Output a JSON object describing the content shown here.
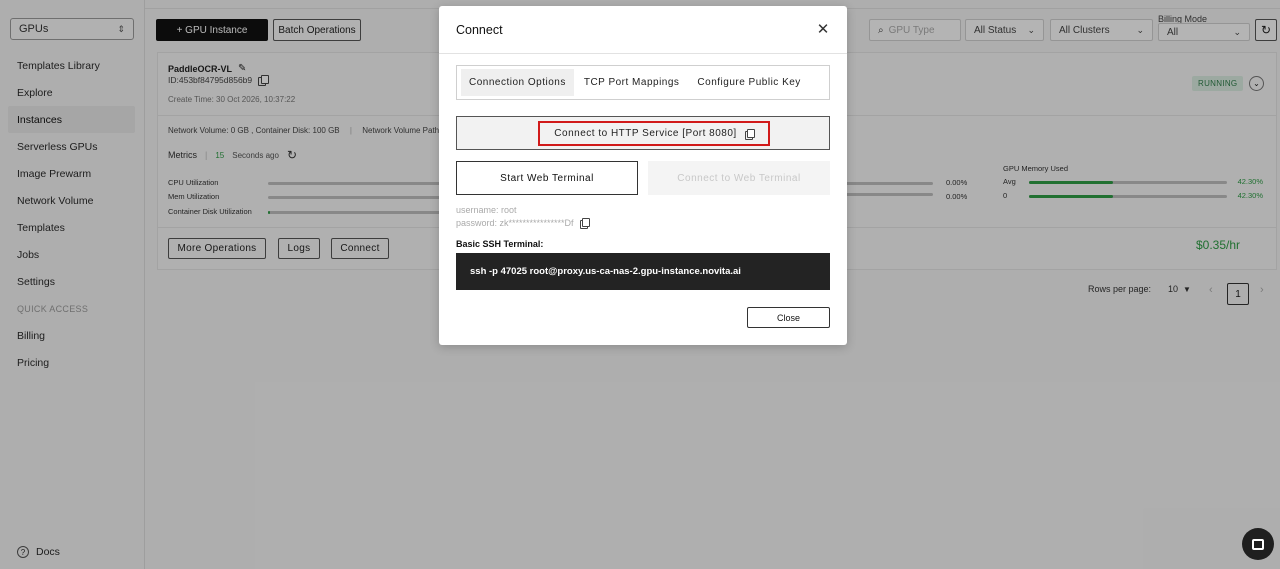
{
  "sidebar": {
    "selector": "GPUs",
    "items": [
      {
        "label": "Templates Library"
      },
      {
        "label": "Explore"
      },
      {
        "label": "Instances"
      },
      {
        "label": "Serverless GPUs"
      },
      {
        "label": "Image Prewarm"
      },
      {
        "label": "Network Volume"
      },
      {
        "label": "Templates"
      },
      {
        "label": "Jobs"
      },
      {
        "label": "Settings"
      }
    ],
    "quick_access_label": "QUICK ACCESS",
    "quick_items": [
      {
        "label": "Billing"
      },
      {
        "label": "Pricing"
      }
    ],
    "docs_label": "Docs"
  },
  "toolbar": {
    "gpu_instance": "+ GPU Instance",
    "batch_ops": "Batch Operations",
    "gpu_type_placeholder": "GPU Type",
    "status": "All Status",
    "clusters": "All Clusters",
    "billing_mode_label": "Billing Mode",
    "billing_mode": "All"
  },
  "instance": {
    "name": "PaddleOCR-VL",
    "id": "ID:453bf84795d856b9",
    "create_time": "Create Time: 30 Oct 2026, 10:37:22",
    "status": "RUNNING",
    "volume_info": "Network Volume: 0 GB , Container Disk: 100 GB",
    "volume_path": "Network Volume Path: -",
    "metrics_label": "Metrics",
    "metrics_interval": "15",
    "metrics_ago": "Seconds ago",
    "cpu_label": "CPU Utilization",
    "mem_label": "Mem Utilization",
    "disk_label": "Container Disk Utilization",
    "disk_fill_pct": 1,
    "gpu_util_1": "0.00%",
    "gpu_util_2": "0.00%",
    "gpu_mem_title": "GPU Memory Used",
    "gpu_mem_rows": [
      {
        "label": "Avg",
        "pct": "42.30%",
        "value": 42.3
      },
      {
        "label": "0",
        "pct": "42.30%",
        "value": 42.3
      }
    ],
    "more_ops": "More Operations",
    "logs": "Logs",
    "connect": "Connect",
    "price": "$0.35/hr"
  },
  "pagination": {
    "rows_per_page_label": "Rows per page:",
    "rows_per_page": "10",
    "current_page": "1"
  },
  "modal": {
    "title": "Connect",
    "tabs": [
      {
        "label": "Connection Options"
      },
      {
        "label": "TCP Port Mappings"
      },
      {
        "label": "Configure Public Key"
      }
    ],
    "http_service": "Connect to HTTP Service [Port 8080]",
    "start_web_terminal": "Start Web Terminal",
    "connect_web_terminal": "Connect to Web Terminal",
    "username": "username: root",
    "password": "password: zk****************Df",
    "ssh_label": "Basic SSH Terminal:",
    "ssh_command": "ssh -p 47025 root@proxy.us-ca-nas-2.gpu-instance.novita.ai",
    "close": "Close"
  },
  "colors": {
    "accent_green": "#2e9b45",
    "highlight_red": "#d11a1a"
  }
}
